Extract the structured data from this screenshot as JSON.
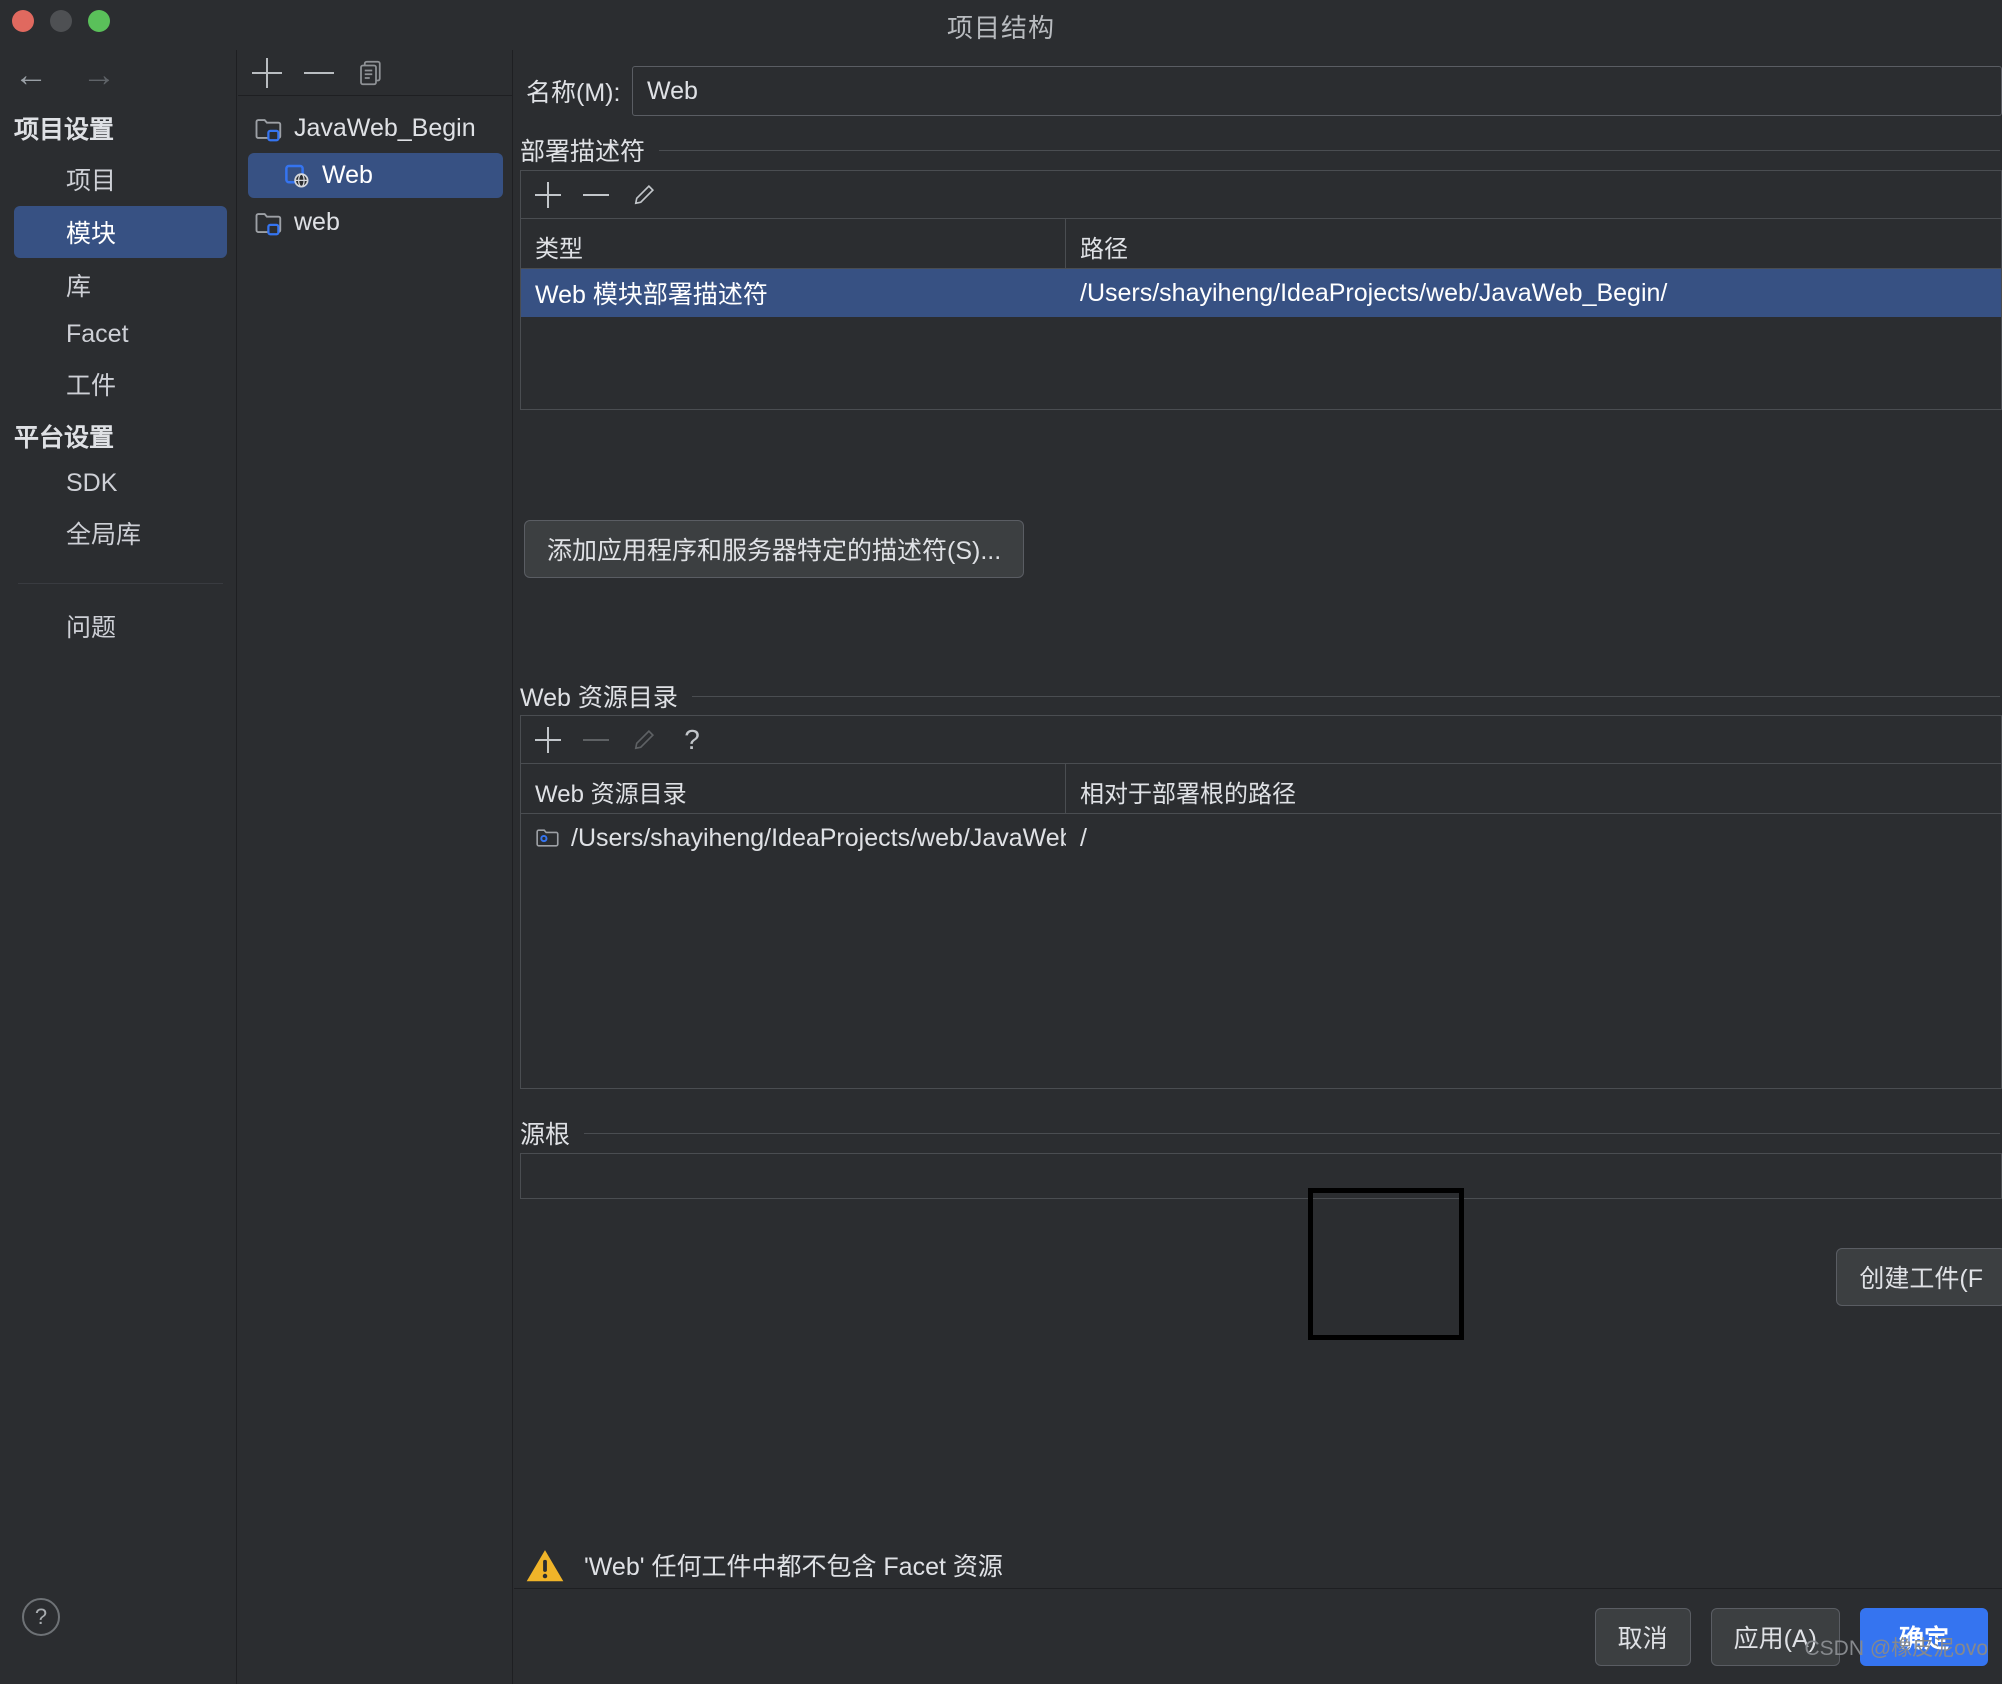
{
  "window": {
    "title": "项目结构",
    "traffic_lights": [
      "close-red",
      "minimize-yellow",
      "zoom-green"
    ]
  },
  "nav": {
    "back": "←",
    "forward": "→"
  },
  "sidebar": {
    "groups": [
      {
        "label": "项目设置",
        "items": [
          {
            "label": "项目",
            "selected": false
          },
          {
            "label": "模块",
            "selected": true
          },
          {
            "label": "库",
            "selected": false
          },
          {
            "label": "Facet",
            "selected": false
          },
          {
            "label": "工件",
            "selected": false
          }
        ]
      },
      {
        "label": "平台设置",
        "items": [
          {
            "label": "SDK",
            "selected": false
          },
          {
            "label": "全局库",
            "selected": false
          }
        ]
      }
    ],
    "issues_label": "问题",
    "help_glyph": "?"
  },
  "tree": {
    "toolbar": {
      "add": "+",
      "remove": "−",
      "copy": "copy-icon"
    },
    "items": [
      {
        "label": "JavaWeb_Begin",
        "icon": "module-folder-icon",
        "depth": 0,
        "selected": false
      },
      {
        "label": "Web",
        "icon": "web-facet-icon",
        "depth": 1,
        "selected": true
      },
      {
        "label": "web",
        "icon": "module-folder-icon",
        "depth": 0,
        "selected": false
      }
    ]
  },
  "main": {
    "name_label": "名称(M):",
    "name_value": "Web",
    "deployment": {
      "section_title": "部署描述符",
      "toolbar": {
        "add": "+",
        "remove": "−",
        "edit": "pencil-icon"
      },
      "columns": [
        "类型",
        "路径"
      ],
      "rows": [
        {
          "type": "Web 模块部署描述符",
          "path": "/Users/shayiheng/IdeaProjects/web/JavaWeb_Begin/",
          "selected": true
        }
      ],
      "add_descriptor_button": "添加应用程序和服务器特定的描述符(S)..."
    },
    "web_resource": {
      "section_title": "Web 资源目录",
      "toolbar": {
        "add": "+",
        "remove": "−",
        "edit": "pencil-icon",
        "help": "?"
      },
      "columns": [
        "Web 资源目录",
        "相对于部署根的路径"
      ],
      "rows": [
        {
          "dir": "/Users/shayiheng/IdeaProjects/web/JavaWeb_Be...",
          "relative_path": "/",
          "icon": "folder-icon"
        }
      ]
    },
    "source_root": {
      "section_title": "源根",
      "rows": []
    },
    "warning": {
      "icon": "warning-triangle-icon",
      "text": "'Web' 任何工件中都不包含 Facet 资源"
    },
    "create_artifact_button": "创建工件(F",
    "buttons": {
      "cancel": "取消",
      "apply": "应用(A)",
      "ok": "确定"
    }
  },
  "watermark": "CSDN @橡皮泥ovo",
  "colors": {
    "background": "#2b2d30",
    "selection": "#375183",
    "accent": "#3574f0",
    "warning": "#f0b429",
    "border": "#4a4d51",
    "text": "#dfe1e5"
  }
}
